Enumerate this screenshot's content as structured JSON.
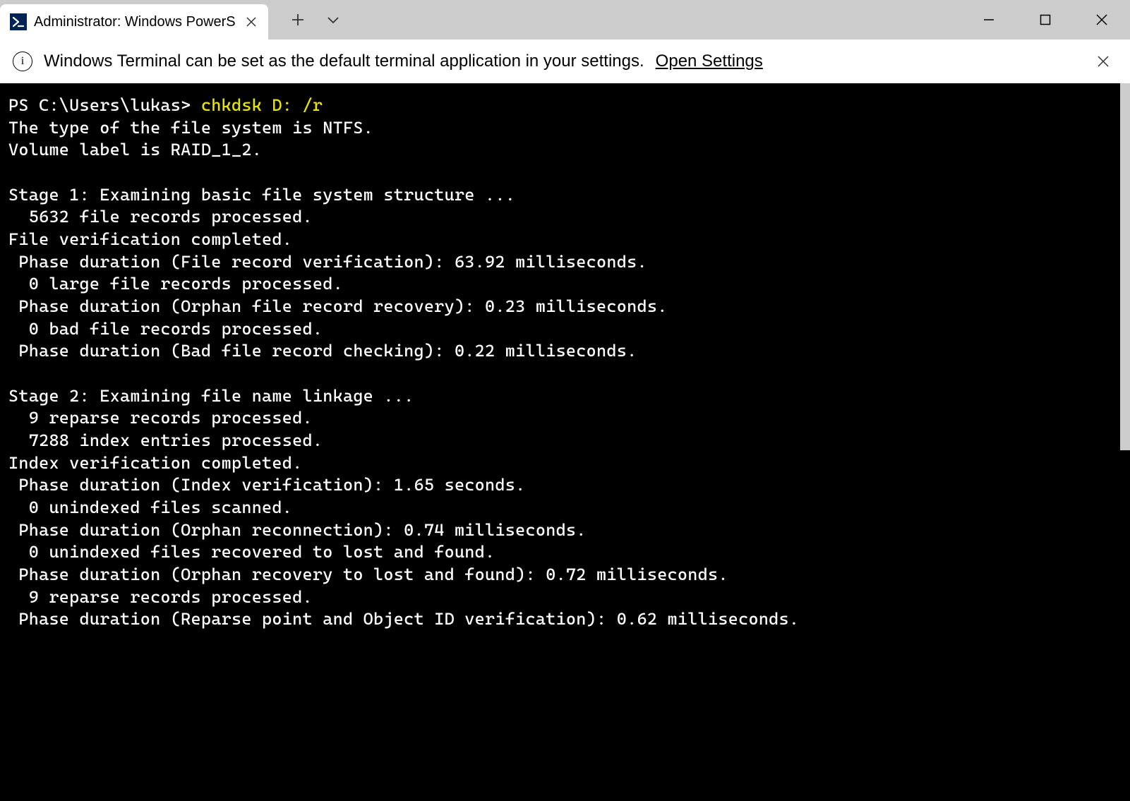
{
  "window": {
    "tab_title": "Administrator: Windows PowerS",
    "minimize_tip": "Minimize",
    "maximize_tip": "Maximize",
    "close_tip": "Close"
  },
  "infobar": {
    "message": "Windows Terminal can be set as the default terminal application in your settings.",
    "link": "Open Settings"
  },
  "terminal": {
    "prompt": "PS C:\\Users\\lukas> ",
    "command": "chkdsk D: /r",
    "lines": [
      "The type of the file system is NTFS.",
      "Volume label is RAID_1_2.",
      "",
      "Stage 1: Examining basic file system structure ...",
      "  5632 file records processed.",
      "File verification completed.",
      " Phase duration (File record verification): 63.92 milliseconds.",
      "  0 large file records processed.",
      " Phase duration (Orphan file record recovery): 0.23 milliseconds.",
      "  0 bad file records processed.",
      " Phase duration (Bad file record checking): 0.22 milliseconds.",
      "",
      "Stage 2: Examining file name linkage ...",
      "  9 reparse records processed.",
      "  7288 index entries processed.",
      "Index verification completed.",
      " Phase duration (Index verification): 1.65 seconds.",
      "  0 unindexed files scanned.",
      " Phase duration (Orphan reconnection): 0.74 milliseconds.",
      "  0 unindexed files recovered to lost and found.",
      " Phase duration (Orphan recovery to lost and found): 0.72 milliseconds.",
      "  9 reparse records processed.",
      " Phase duration (Reparse point and Object ID verification): 0.62 milliseconds."
    ]
  }
}
